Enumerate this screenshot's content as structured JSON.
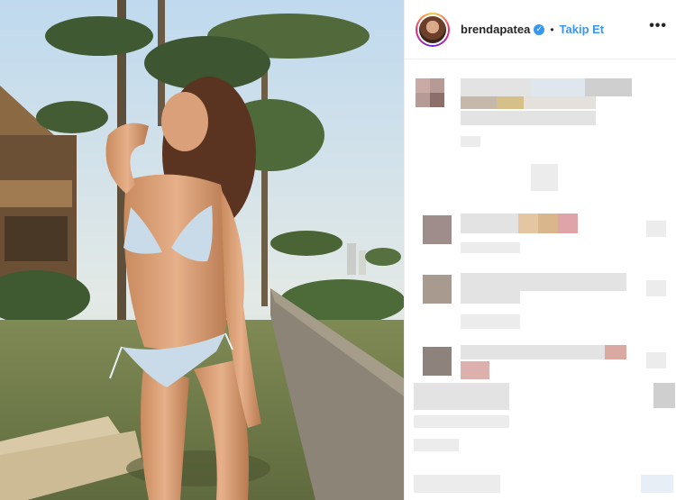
{
  "post": {
    "username": "brendapatea",
    "verified_glyph": "✓",
    "separator": "•",
    "follow_label": "Takip Et",
    "more_label": "•••"
  },
  "icons": {
    "verified": "verified-badge-icon",
    "more": "more-options-icon"
  },
  "colors": {
    "link_blue": "#3897f0",
    "text": "#262626",
    "border": "#efefef"
  }
}
